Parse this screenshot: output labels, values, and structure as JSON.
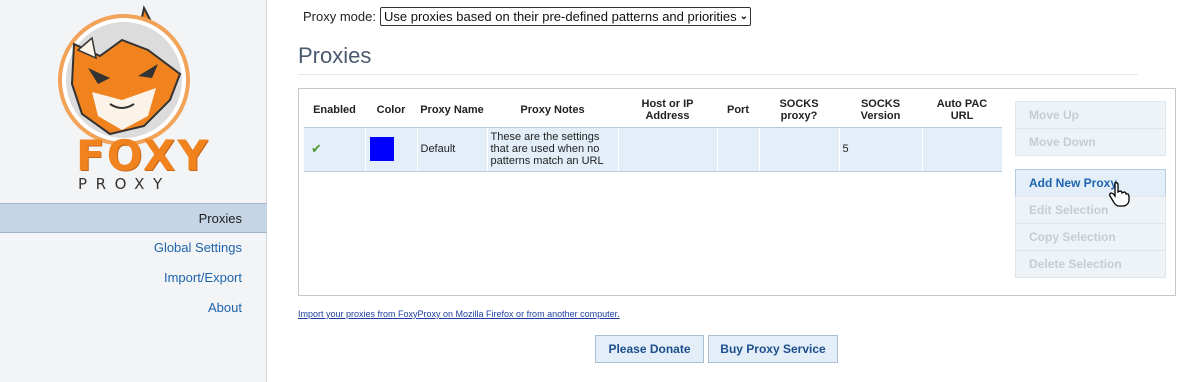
{
  "sidebar": {
    "logo": {
      "word": "FOXY",
      "sub": "PROXY"
    },
    "items": [
      {
        "label": "Proxies",
        "active": true
      },
      {
        "label": "Global Settings"
      },
      {
        "label": "Import/Export"
      },
      {
        "label": "About"
      }
    ]
  },
  "header": {
    "mode_label": "Proxy mode:",
    "mode_value": "Use proxies based on their pre-defined patterns and priorities"
  },
  "main": {
    "title": "Proxies",
    "table": {
      "columns": [
        "Enabled",
        "Color",
        "Proxy Name",
        "Proxy Notes",
        "Host or IP Address",
        "Port",
        "SOCKS proxy?",
        "SOCKS Version",
        "Auto PAC URL"
      ],
      "rows": [
        {
          "enabled": "✔",
          "color": "#0000ff",
          "name": "Default",
          "notes": "These are the settings that are used when no patterns match an URL",
          "host": "",
          "port": "",
          "socks": "",
          "socks_version": "5",
          "pac_url": ""
        }
      ]
    },
    "buttons": {
      "move_up": "Move Up",
      "move_down": "Move Down",
      "add_new": "Add New Proxy",
      "edit": "Edit Selection",
      "copy": "Copy Selection",
      "delete": "Delete Selection"
    },
    "import_link": "Import your proxies from FoxyProxy on Mozilla Firefox or from another computer.",
    "donate": "Please Donate",
    "buy": "Buy Proxy Service"
  },
  "colors": {
    "accent": "#1d63ad",
    "sidebar_active": "#c5d5e6",
    "row_bg": "#e3eef9",
    "logo_orange": "#f0831e"
  }
}
